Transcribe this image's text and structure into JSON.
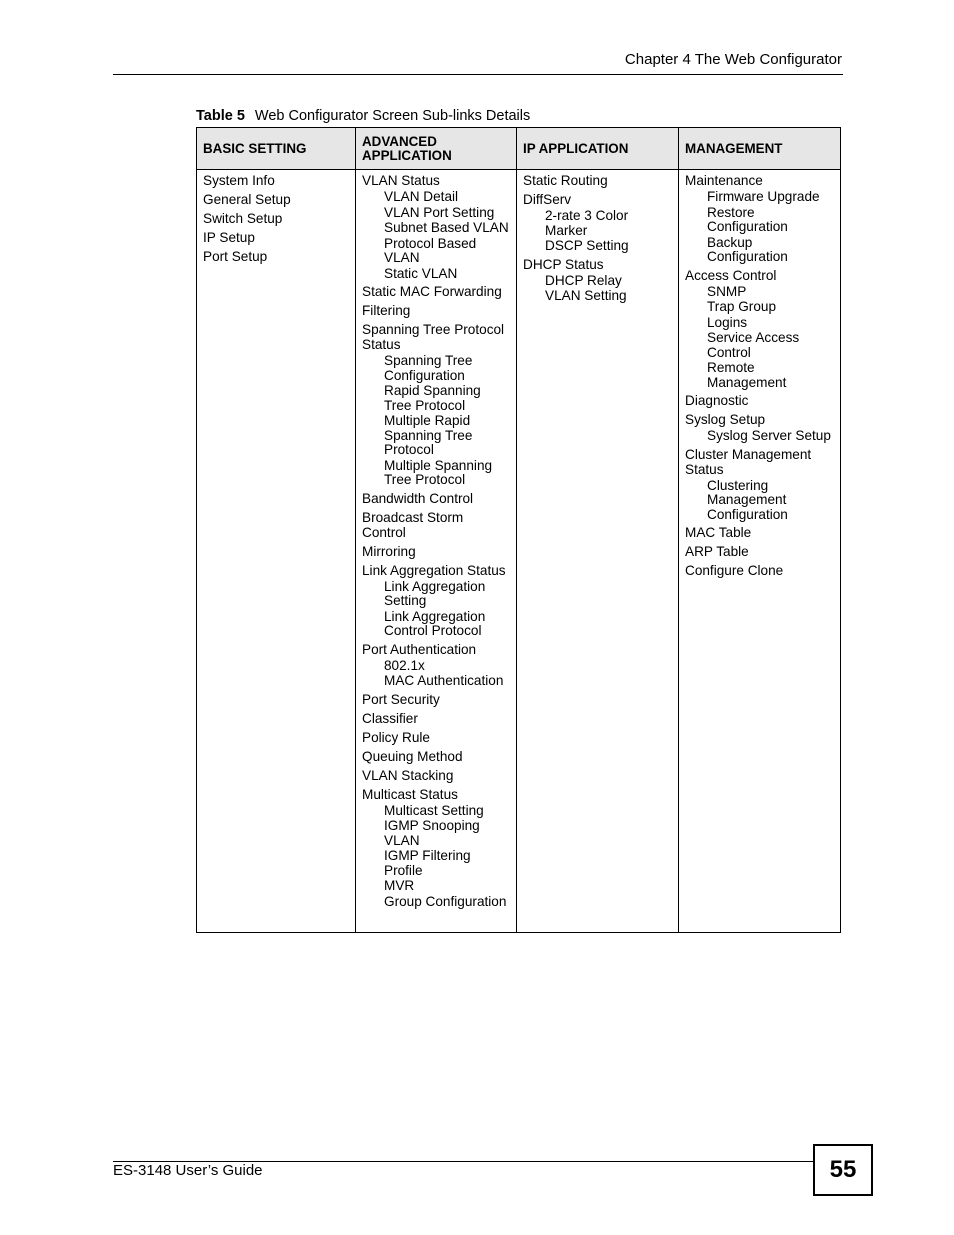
{
  "header": {
    "chapter_title": "Chapter 4 The Web Configurator"
  },
  "caption": {
    "label": "Table 5",
    "text": "Web Configurator Screen Sub-links Details"
  },
  "table": {
    "columns": [
      {
        "header": "BASIC SETTING",
        "entries": [
          {
            "label": "System Info",
            "sub": []
          },
          {
            "label": "General Setup",
            "sub": []
          },
          {
            "label": "Switch Setup",
            "sub": []
          },
          {
            "label": "IP Setup",
            "sub": []
          },
          {
            "label": "Port Setup",
            "sub": []
          }
        ]
      },
      {
        "header": "ADVANCED APPLICATION",
        "entries": [
          {
            "label": "VLAN Status",
            "sub": [
              "VLAN Detail",
              "VLAN Port Setting",
              "Subnet Based VLAN",
              "Protocol Based VLAN",
              "Static VLAN"
            ]
          },
          {
            "label": "Static MAC Forwarding",
            "sub": []
          },
          {
            "label": "Filtering",
            "sub": []
          },
          {
            "label": "Spanning Tree Protocol Status",
            "sub": [
              "Spanning Tree Configuration",
              "Rapid Spanning Tree Protocol",
              "Multiple Rapid Spanning Tree Protocol",
              "Multiple Spanning Tree Protocol"
            ]
          },
          {
            "label": "Bandwidth Control",
            "sub": []
          },
          {
            "label": "Broadcast Storm Control",
            "sub": []
          },
          {
            "label": "Mirroring",
            "sub": []
          },
          {
            "label": "Link Aggregation Status",
            "sub": [
              "Link Aggregation Setting",
              "Link Aggregation Control Protocol"
            ]
          },
          {
            "label": "Port Authentication",
            "sub": [
              "802.1x",
              "MAC Authentication"
            ]
          },
          {
            "label": "Port Security",
            "sub": []
          },
          {
            "label": "Classifier",
            "sub": []
          },
          {
            "label": "Policy Rule",
            "sub": []
          },
          {
            "label": "Queuing Method",
            "sub": []
          },
          {
            "label": "VLAN Stacking",
            "sub": []
          },
          {
            "label": "Multicast Status",
            "sub": [
              "Multicast Setting",
              "IGMP Snooping VLAN",
              "IGMP Filtering Profile",
              "MVR",
              "Group Configuration"
            ]
          }
        ]
      },
      {
        "header": "IP APPLICATION",
        "entries": [
          {
            "label": "Static Routing",
            "sub": []
          },
          {
            "label": "DiffServ",
            "sub": [
              "2-rate 3 Color Marker",
              "DSCP Setting"
            ]
          },
          {
            "label": "DHCP Status",
            "sub": [
              "DHCP Relay",
              "VLAN Setting"
            ]
          }
        ]
      },
      {
        "header": "MANAGEMENT",
        "entries": [
          {
            "label": "Maintenance",
            "sub": [
              "Firmware Upgrade",
              "Restore Configuration",
              "Backup Configuration"
            ]
          },
          {
            "label": "Access Control",
            "sub": [
              "SNMP",
              "Trap Group",
              "Logins",
              "Service Access Control",
              "Remote Management"
            ]
          },
          {
            "label": "Diagnostic",
            "sub": []
          },
          {
            "label": "Syslog Setup",
            "sub": [
              "Syslog Server Setup"
            ]
          },
          {
            "label": "Cluster Management Status",
            "sub": [
              "Clustering Management Configuration"
            ]
          },
          {
            "label": "MAC Table",
            "sub": []
          },
          {
            "label": "ARP Table",
            "sub": []
          },
          {
            "label": "Configure Clone",
            "sub": []
          }
        ]
      }
    ]
  },
  "footer": {
    "guide_title": "ES-3148 User’s Guide",
    "page_number": "55"
  }
}
